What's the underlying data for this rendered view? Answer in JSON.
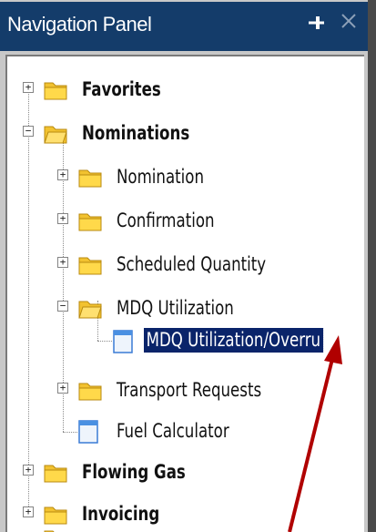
{
  "panel": {
    "title": "Navigation Panel",
    "pin_glyph": "⊣",
    "close_glyph": "✕"
  },
  "tree": {
    "favorites": "Favorites",
    "nominations": "Nominations",
    "nomination": "Nomination",
    "confirmation": "Confirmation",
    "scheduled_quantity": "Scheduled Quantity",
    "mdq_utilization": "MDQ Utilization",
    "mdq_overrun": "MDQ Utilization/Overru",
    "transport_requests": "Transport Requests",
    "fuel_calculator": "Fuel Calculator",
    "flowing_gas": "Flowing Gas",
    "invoicing": "Invoicing"
  },
  "colors": {
    "title_bg": "#143c6a",
    "selection_bg": "#0a246a",
    "annotation_arrow": "#b00000"
  }
}
